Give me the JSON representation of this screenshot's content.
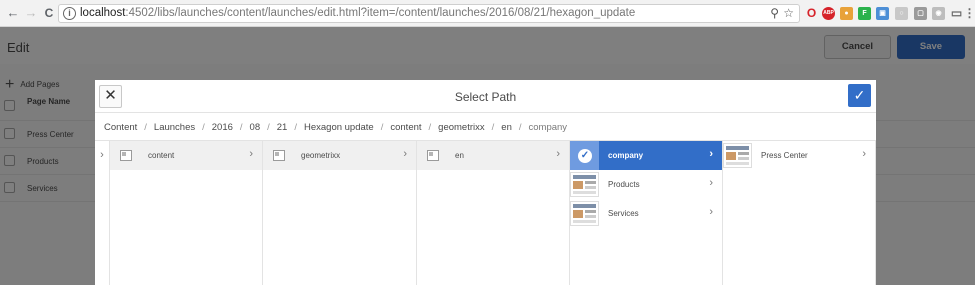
{
  "browser": {
    "url_host": "localhost",
    "url_rest": ":4502/libs/launches/content/launches/edit.html?item=/content/launches/2016/08/21/hexagon_update",
    "back_icon": "←",
    "forward_icon": "→",
    "reload_icon": "C",
    "info_icon": "i",
    "zoom_icon": "⚲",
    "star_icon": "☆",
    "extensions": [
      {
        "name": "opera-icon",
        "color": "#d6232a",
        "glyph": "O"
      },
      {
        "name": "adblock-icon",
        "color": "#d6232a",
        "glyph": "ABP"
      },
      {
        "name": "cookie-icon",
        "color": "#e8a23a",
        "glyph": "●"
      },
      {
        "name": "feedly-icon",
        "color": "#2bb24c",
        "glyph": "F"
      },
      {
        "name": "extension-blue-icon",
        "color": "#4d8fd6",
        "glyph": "▣"
      },
      {
        "name": "extension-grey-icon",
        "color": "#c8c8c8",
        "glyph": "○"
      },
      {
        "name": "extension-grey2-icon",
        "color": "#9a9a9a",
        "glyph": "▢"
      },
      {
        "name": "extension-grey3-icon",
        "color": "#bdbdbd",
        "glyph": "◉"
      },
      {
        "name": "cast-icon",
        "color": "#6a6a6a",
        "glyph": "▭"
      },
      {
        "name": "menu-icon",
        "color": "#6a6a6a",
        "glyph": "⋮"
      }
    ]
  },
  "editor": {
    "title": "Edit",
    "cancel_label": "Cancel",
    "save_label": "Save",
    "add_pages_label": "Add Pages",
    "column_header": "Page Name",
    "rows": [
      "Press Center",
      "Products",
      "Services"
    ]
  },
  "dialog": {
    "title": "Select Path",
    "close_icon": "✕",
    "confirm_icon": "✓",
    "breadcrumbs": [
      "Content",
      "Launches",
      "2016",
      "08",
      "21",
      "Hexagon update",
      "content",
      "geometrixx",
      "en",
      "company"
    ],
    "columns": [
      {
        "items": [
          {
            "label": "content",
            "state": "path"
          }
        ]
      },
      {
        "items": [
          {
            "label": "geometrixx",
            "state": "path"
          }
        ]
      },
      {
        "items": [
          {
            "label": "en",
            "state": "path"
          }
        ]
      },
      {
        "items": [
          {
            "label": "company",
            "state": "active"
          },
          {
            "label": "Products",
            "state": "normal"
          },
          {
            "label": "Services",
            "state": "normal"
          }
        ]
      },
      {
        "items": [
          {
            "label": "Press Center",
            "state": "normal"
          }
        ]
      }
    ],
    "chevron": "›",
    "root_chevron": "›",
    "accent_color": "#326ec8"
  }
}
